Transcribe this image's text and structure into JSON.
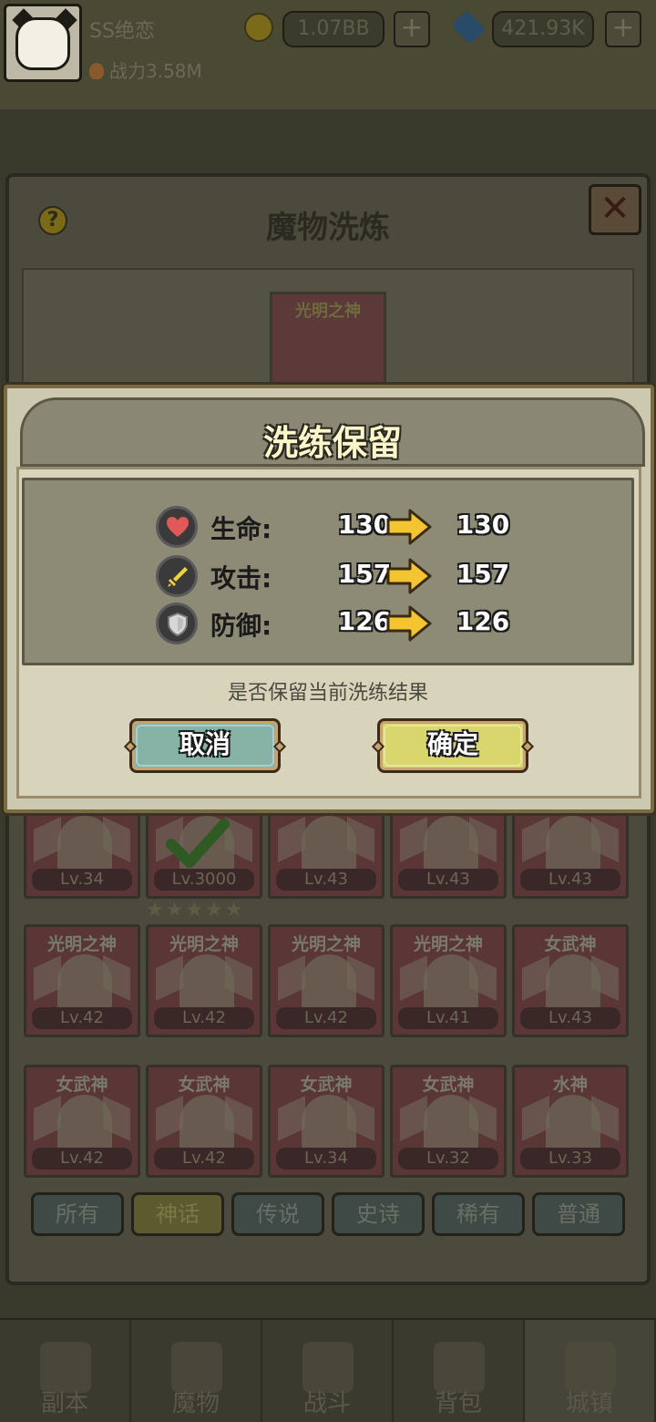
{
  "header": {
    "player_name": "SS绝恋",
    "power_label": "战力3.58M",
    "coins": "1.07BB",
    "gems": "421.93K",
    "plus": "+"
  },
  "panel": {
    "title": "魔物洗炼",
    "help": "?",
    "close": "✕",
    "selected_monster": "光明之神"
  },
  "cards": [
    {
      "name": "",
      "level": "Lv.34"
    },
    {
      "name": "",
      "level": "Lv.3000"
    },
    {
      "name": "",
      "level": "Lv.43"
    },
    {
      "name": "",
      "level": "Lv.43"
    },
    {
      "name": "",
      "level": "Lv.43"
    },
    {
      "name": "光明之神",
      "level": "Lv.42"
    },
    {
      "name": "光明之神",
      "level": "Lv.42"
    },
    {
      "name": "光明之神",
      "level": "Lv.42"
    },
    {
      "name": "光明之神",
      "level": "Lv.41"
    },
    {
      "name": "女武神",
      "level": "Lv.43"
    },
    {
      "name": "女武神",
      "level": "Lv.42"
    },
    {
      "name": "女武神",
      "level": "Lv.42"
    },
    {
      "name": "女武神",
      "level": "Lv.34"
    },
    {
      "name": "女武神",
      "level": "Lv.32"
    },
    {
      "name": "水神",
      "level": "Lv.33"
    }
  ],
  "stars": "★★★★★",
  "filters": [
    "所有",
    "神话",
    "传说",
    "史诗",
    "稀有",
    "普通"
  ],
  "active_filter": 1,
  "nav": [
    "副本",
    "魔物",
    "战斗",
    "背包",
    "城镇"
  ],
  "active_nav": 4,
  "modal": {
    "title": "洗练保留",
    "stats": [
      {
        "icon": "heart-icon",
        "label": "生命:",
        "old": "130",
        "new": "130"
      },
      {
        "icon": "sword-icon",
        "label": "攻击:",
        "old": "157",
        "new": "157"
      },
      {
        "icon": "shield-icon",
        "label": "防御:",
        "old": "126",
        "new": "126"
      }
    ],
    "prompt": "是否保留当前洗练结果",
    "cancel_label": "取消",
    "confirm_label": "确定"
  },
  "colors": {
    "cancel_button": "#86b3a6",
    "confirm_button": "#d9d66e",
    "modal_bg": "#cdc9b0",
    "arrow": "#f5c531",
    "heart": "#e05858"
  }
}
